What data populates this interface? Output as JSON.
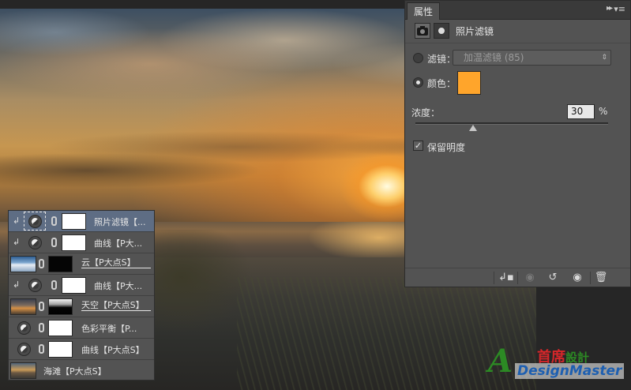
{
  "properties_panel": {
    "tab_label": "属性",
    "arrows": "▸▸",
    "menu_icon": "▾≡",
    "title": "照片滤镜",
    "filter_label": "滤镜：",
    "filter_value": "加温滤镜 (85)",
    "color_label": "颜色：",
    "color_swatch": "#ffa52b",
    "density_label": "浓度：",
    "density_value": "30",
    "density_unit": "%",
    "density_level_percent": 30,
    "preserve_luminosity_label": "保留明度",
    "preserve_luminosity_checked": true,
    "selected_mode": "color",
    "footer_icons": [
      "clip-to-layer-icon",
      "view-previous-state-icon",
      "reset-icon",
      "visibility-icon",
      "trash-icon"
    ]
  },
  "layers": [
    {
      "name": "照片滤镜【...",
      "type": "adjustment",
      "clipped": true,
      "selected": true,
      "mask": "white"
    },
    {
      "name": "曲线【P大...",
      "type": "adjustment",
      "clipped": true,
      "selected": false,
      "mask": "white"
    },
    {
      "name": "云【P大点S】",
      "type": "image",
      "thumb": "cloud",
      "clipped": false,
      "selected": false,
      "mask": "black",
      "underlined": true
    },
    {
      "name": "曲线【P大...",
      "type": "adjustment",
      "clipped": true,
      "selected": false,
      "mask": "white"
    },
    {
      "name": "天空【P大点S】",
      "type": "image",
      "thumb": "sky",
      "clipped": false,
      "selected": false,
      "mask": "sky",
      "underlined": true
    },
    {
      "name": "色彩平衡【P...",
      "type": "adjustment",
      "clipped": false,
      "selected": false,
      "mask": "white"
    },
    {
      "name": "曲线【P大点S】",
      "type": "adjustment",
      "clipped": false,
      "selected": false,
      "mask": "white"
    },
    {
      "name": "海滩【P大点S】",
      "type": "image",
      "thumb": "beach",
      "clipped": false,
      "selected": false,
      "mask": "none"
    }
  ],
  "watermark": {
    "logo_letter": "A",
    "chinese_main": "首席",
    "chinese_sub": "設計",
    "english": "DesignMaster"
  }
}
